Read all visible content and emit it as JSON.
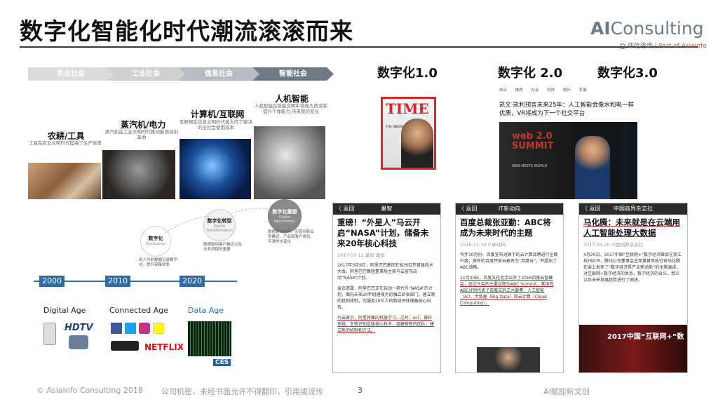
{
  "slide": {
    "title": "数字化智能化时代潮流滚滚而来",
    "logo": {
      "main_ai": "AI",
      "main_rest": "Consulting",
      "sub_cn": "亚信咨询",
      "sub_part": "Part of AsiaInfo"
    }
  },
  "timeline": {
    "stages": [
      "农业社会",
      "工业社会",
      "信息社会",
      "智能社会"
    ],
    "eras": [
      {
        "title": "农耕/工具",
        "desc": "工具在农业文明时代提高了生产效率"
      },
      {
        "title": "蒸汽机/电力",
        "desc": "蒸汽机在工业文明时代推动能源深刻革命"
      },
      {
        "title": "计算机/互联网",
        "desc": "互联网在信息文明时代极大的了解决的全社会使用成本"
      },
      {
        "title": "人机智能",
        "desc": "人机智能在智能文明中将极大改变和提升个体能力,带来我的变化"
      }
    ],
    "circles": [
      {
        "name": "数字化",
        "en": "Digitization",
        "desc": "用人为的数据记录数字化、提升采集效率"
      },
      {
        "name": "数字化转型",
        "en": "Digital Transformation",
        "desc": "数据驱动客户触达以及业务流程的重要"
      },
      {
        "name": "数字化重塑",
        "en": "Digital Reinvention",
        "desc": "数据驱动技术、实现创新业务模式、产品和客户体验、平滑的去变化"
      }
    ]
  },
  "ages": {
    "years": [
      "2000",
      "2010",
      "2020"
    ],
    "labels": [
      "Digital Age",
      "Connected Age",
      "Data Age"
    ],
    "logos": {
      "hdtv": "HDTV",
      "netflix": "NETFLIX",
      "ces": "CES"
    }
  },
  "headers": {
    "d1": "数字化1.0",
    "d2": "数字化 2.0",
    "d3": "数字化3.0"
  },
  "time_cover": {
    "mag": "TIME",
    "sub": "THE INNOVATOR"
  },
  "news_top": {
    "menu": "热点 推荐 社会 科技 娱乐 军事",
    "headline": "凯文·凯利预言未来25年：人工智能会像水和电一样优质，VR将成为下一个社交平台",
    "summit": "web 2.0 SUMMIT",
    "tagline": "WEB MEETS WORLD"
  },
  "phones": [
    {
      "back": "〈 返回",
      "bar_title": "巢智",
      "headline": "重磅！“外星人”马云开启“NASA”计划，储备未来20年核心科技",
      "meta": "2017-03-13  巢智  巢智",
      "body1": "2017年3月9日，阿里巴巴集团在杭州召开首届技术大会。阿里巴巴集团董事局主席马云宣布启动“NASA”计划。",
      "body2": "会议透露，阿里巴巴正在启动一项代号“NASA”的计划，面向未来20年组建强大的独立研发部门，建立新的机制体制，为服务20亿人的新经济体储备核心科技。",
      "body3": "马云表示，阿里将面向机器学习、芯片、IoT、操作系统、生物识别这些核心技术，组建崭新的团队，建立新的机制和方法。"
    },
    {
      "back": "〈 返回",
      "bar_title": "IT新动向",
      "headline": "百度总裁张亚勤：ABC将成为未来时代的主题",
      "meta": "2016-11-30  IT新动向",
      "body1": "今年10月份，百度宣布对旗下的云计算品牌进行全面升级，原有的百度开放云更名为“百度云”，并提出了ABC战略。",
      "body2": "11月30日，百度又在北京召开了2016百度云智峰会，这次大会的主要议题为ABC Summit。其中的ABC分别代表了百度云的三大要素：人工智能（AI）、大数据（Big Data）和云计算（Cloud Computing）。"
    },
    {
      "back": "〈 返回",
      "bar_title": "中国商界杂志社",
      "headline": "马化腾：未来就是在云端用人工智能处理大数据",
      "meta": "2017-04-20  中国商界杂志社",
      "body1": "4月20日，2017中国“互联网+”数字经济峰会在浙江杭州召开，腾讯公司董事会主席兼首席执行官马化腾在会上发表了“数字经济是产业新动能”的主题演讲，对互联网+数字经济的关系，数字经济的含义、意义以及未来发展趋势进行了阐述。",
      "banner": "2017中国“互联网+”数"
    }
  ],
  "footer": {
    "copyright": "© AsiaInfo Consulting 2018",
    "confidential": "公司机密，未经书面允许不得翻印，引用或流传",
    "page": "3",
    "tagline": "AI赋能新文创"
  },
  "colors": {
    "accent_blue": "#2c6aa8",
    "underline_red": "#d9262c",
    "chevron_gray": "#c9c9c9",
    "chevron_dark": "#6f7a85"
  }
}
